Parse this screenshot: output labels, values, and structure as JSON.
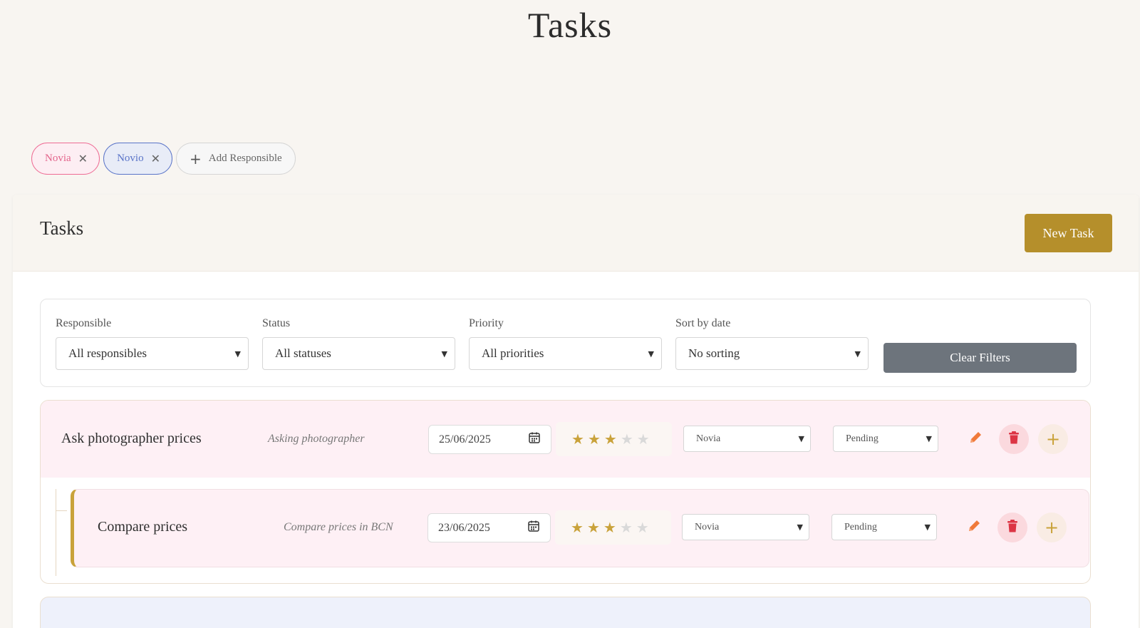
{
  "page": {
    "title": "Tasks"
  },
  "responsibles": [
    {
      "label": "Novia",
      "color": "#ee6b94"
    },
    {
      "label": "Novio",
      "color": "#5a74c8"
    }
  ],
  "add_responsible_label": "Add Responsible",
  "panel": {
    "title": "Tasks",
    "new_task_label": "New Task"
  },
  "filters": {
    "responsible": {
      "label": "Responsible",
      "value": "All responsibles"
    },
    "status": {
      "label": "Status",
      "value": "All statuses"
    },
    "priority": {
      "label": "Priority",
      "value": "All priorities"
    },
    "sort": {
      "label": "Sort by date",
      "value": "No sorting"
    },
    "clear_label": "Clear Filters"
  },
  "tasks": [
    {
      "title": "Ask photographer prices",
      "description": "Asking photographer",
      "date": "25/06/2025",
      "priority": 3,
      "priority_max": 5,
      "responsible": "Novia",
      "status": "Pending"
    },
    {
      "title": "Compare prices",
      "description": "Compare prices in BCN",
      "date": "23/06/2025",
      "priority": 3,
      "priority_max": 5,
      "responsible": "Novia",
      "status": "Pending",
      "is_subtask": true
    }
  ],
  "colors": {
    "accent": "#b58f2b",
    "novia": "#ee6b94",
    "novio": "#5a74c8",
    "delete": "#dc3545",
    "edit": "#f07a3a"
  }
}
